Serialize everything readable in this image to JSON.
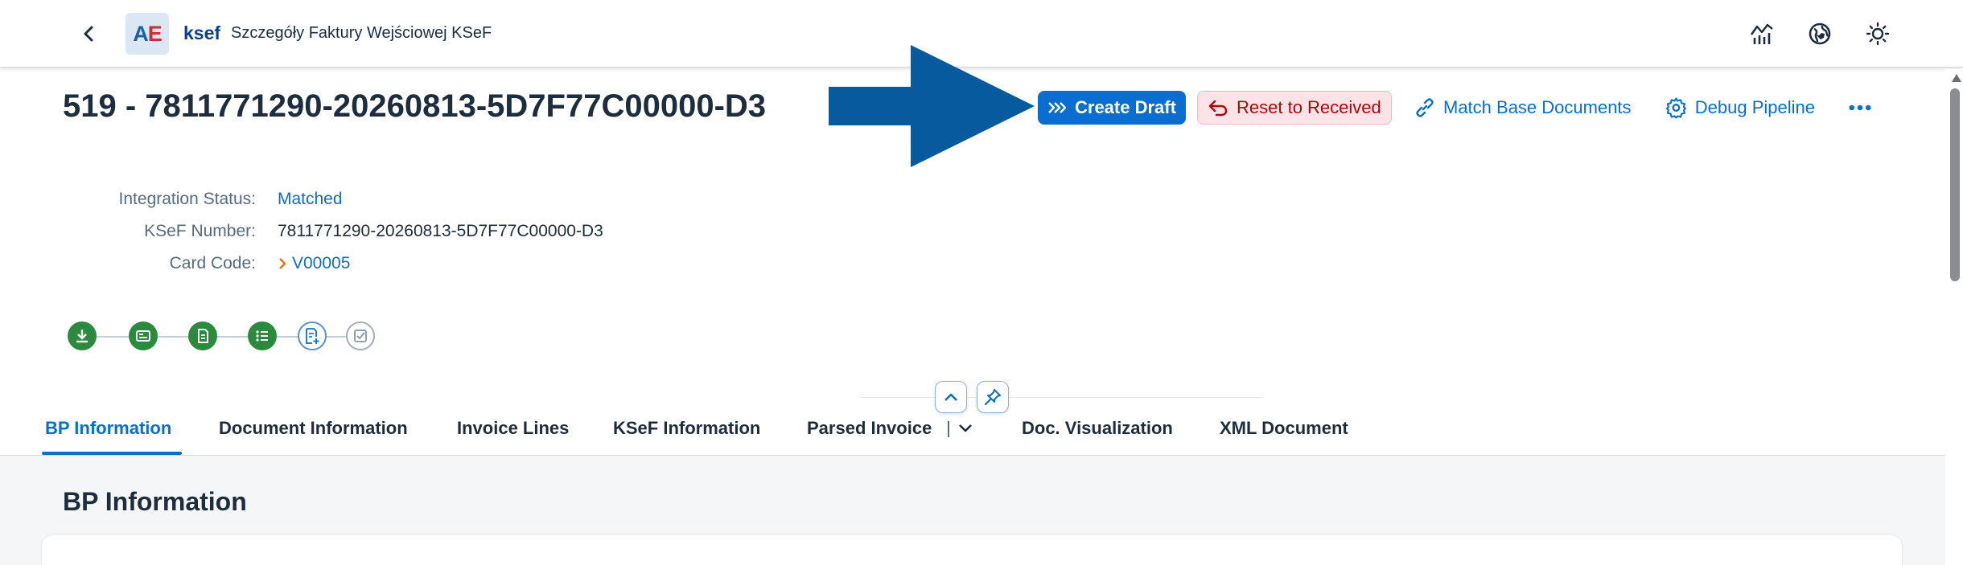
{
  "shell": {
    "logo_text_a": "A",
    "logo_text_e": "E",
    "app_name": "ksef",
    "subtitle": "Szczegóły Faktury Wejściowej KSeF",
    "icons": [
      "back-icon",
      "analytics-icon",
      "globe-icon",
      "sun-icon"
    ]
  },
  "header": {
    "title": "519 - 7811771290-20260813-5D7F77C00000-D3",
    "actions": {
      "create_draft": "Create Draft",
      "reset_to_received": "Reset to Received",
      "match_base_documents": "Match Base Documents",
      "debug_pipeline": "Debug Pipeline",
      "more": "more-icon"
    },
    "attributes": {
      "integration_status_label": "Integration Status:",
      "integration_status_value": "Matched",
      "ksef_number_label": "KSeF Number:",
      "ksef_number_value": "7811771290-20260813-5D7F77C00000-D3",
      "card_code_label": "Card Code:",
      "card_code_value": "V00005"
    },
    "process_steps": [
      {
        "icon": "download-icon",
        "state": "done"
      },
      {
        "icon": "id-card-icon",
        "state": "done"
      },
      {
        "icon": "document-icon",
        "state": "done"
      },
      {
        "icon": "list-icon",
        "state": "done"
      },
      {
        "icon": "add-document-icon",
        "state": "current"
      },
      {
        "icon": "check-square-icon",
        "state": "pending"
      }
    ]
  },
  "tabs": [
    {
      "label": "BP Information",
      "selected": true
    },
    {
      "label": "Document Information",
      "selected": false
    },
    {
      "label": "Invoice Lines",
      "selected": false
    },
    {
      "label": "KSeF Information",
      "selected": false
    },
    {
      "label": "Parsed Invoice",
      "selected": false
    },
    {
      "label": "Doc. Visualization",
      "selected": false
    },
    {
      "label": "XML Document",
      "selected": false
    }
  ],
  "section": {
    "title": "BP Information"
  },
  "colors": {
    "brand_blue": "#0a6ed1",
    "success_green": "#2b8a3e",
    "negative_red": "#aa0808",
    "annotation_arrow": "#075a9e"
  }
}
